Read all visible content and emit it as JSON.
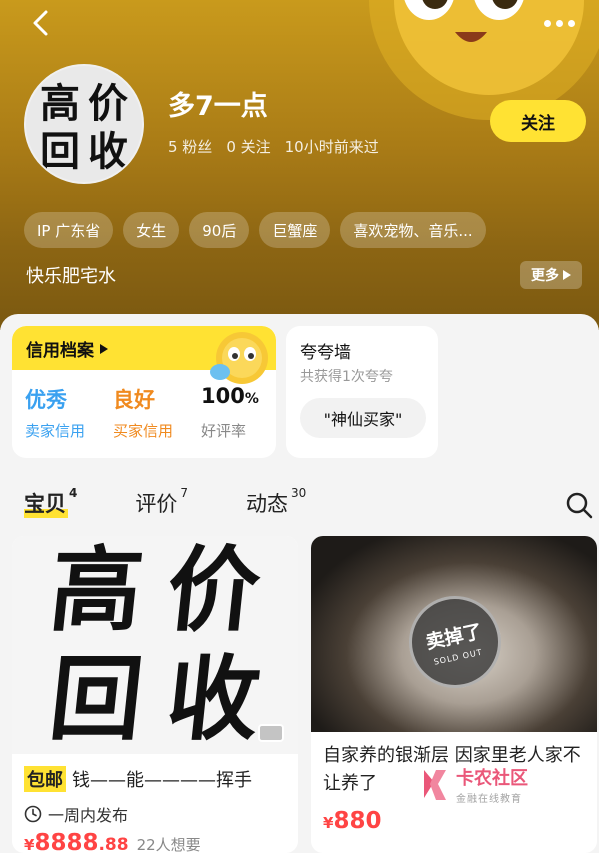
{
  "header": {
    "nickname": "多7一点",
    "avatar_chars": [
      "高",
      "价",
      "回",
      "收"
    ],
    "stats": {
      "fans": "5 粉丝",
      "following": "0 关注",
      "last_seen": "10小时前来过"
    },
    "follow_label": "关注",
    "tags": [
      "IP 广东省",
      "女生",
      "90后",
      "巨蟹座",
      "喜欢宠物、音乐..."
    ],
    "bio": "快乐肥宅水",
    "more_label": "更多"
  },
  "credit": {
    "title": "信用档案",
    "seller": {
      "value": "优秀",
      "label": "卖家信用"
    },
    "buyer": {
      "value": "良好",
      "label": "买家信用"
    },
    "rating": {
      "value": "100",
      "unit": "%",
      "label": "好评率"
    }
  },
  "praise": {
    "title": "夸夸墙",
    "subtitle": "共获得1次夸夸",
    "chip": "\"神仙买家\""
  },
  "tabs": [
    {
      "label": "宝贝",
      "count": "4"
    },
    {
      "label": "评价",
      "count": "7"
    },
    {
      "label": "动态",
      "count": "30"
    }
  ],
  "products": [
    {
      "image_chars": [
        "高",
        "价",
        "回",
        "收"
      ],
      "badge": "包邮",
      "title": "钱——能————挥手",
      "publish": "一周内发布",
      "price_symbol": "¥",
      "price_int": "8888",
      "price_dec": ".88",
      "wants": "22人想要"
    },
    {
      "sold_stamp": "卖掉了",
      "sold_stamp_en": "SOLD OUT",
      "title": "自家养的银渐层 因家里老人家不让养了",
      "price_symbol": "¥",
      "price_int": "880"
    }
  ],
  "watermark": {
    "name": "卡农社区",
    "sub": "金融在线教育"
  },
  "colors": {
    "accent_yellow": "#ffe233",
    "header_gold": "#a97b16",
    "price_red": "#ff4444",
    "credit_blue": "#3aa1f0",
    "credit_orange": "#f08a1f"
  }
}
